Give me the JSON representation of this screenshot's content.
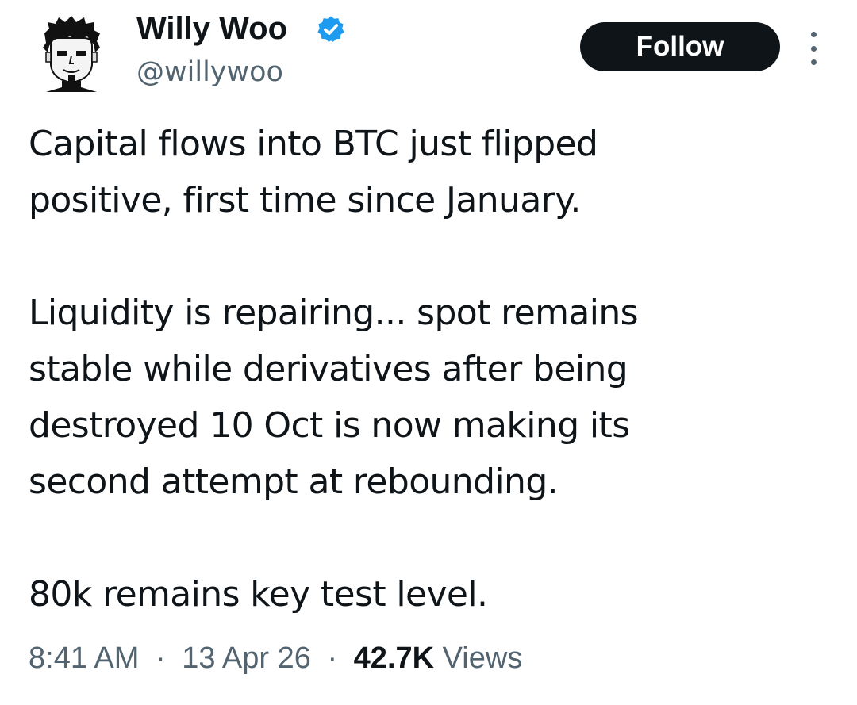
{
  "author": {
    "display_name": "Willy Woo",
    "handle": "@willywoo",
    "verified": true,
    "verified_color": "#1d9bf0"
  },
  "follow_button": {
    "label": "Follow"
  },
  "more_button": {
    "icon": "vertical-ellipsis-icon"
  },
  "tweet": {
    "paragraphs": [
      "Capital flows into BTC just flipped\npositive, first time since January.",
      "Liquidity is repairing... spot remains\nstable while derivatives after being\ndestroyed 10 Oct is now making its\nsecond attempt at rebounding.",
      "80k remains key test level."
    ]
  },
  "meta": {
    "time": "8:41 AM",
    "date": "13 Apr 26",
    "separator": "·",
    "views_count": "42.7K",
    "views_label": "Views"
  },
  "colors": {
    "text_primary": "#0f1419",
    "text_secondary": "#536471",
    "button_bg": "#0f1419",
    "button_text": "#ffffff"
  }
}
